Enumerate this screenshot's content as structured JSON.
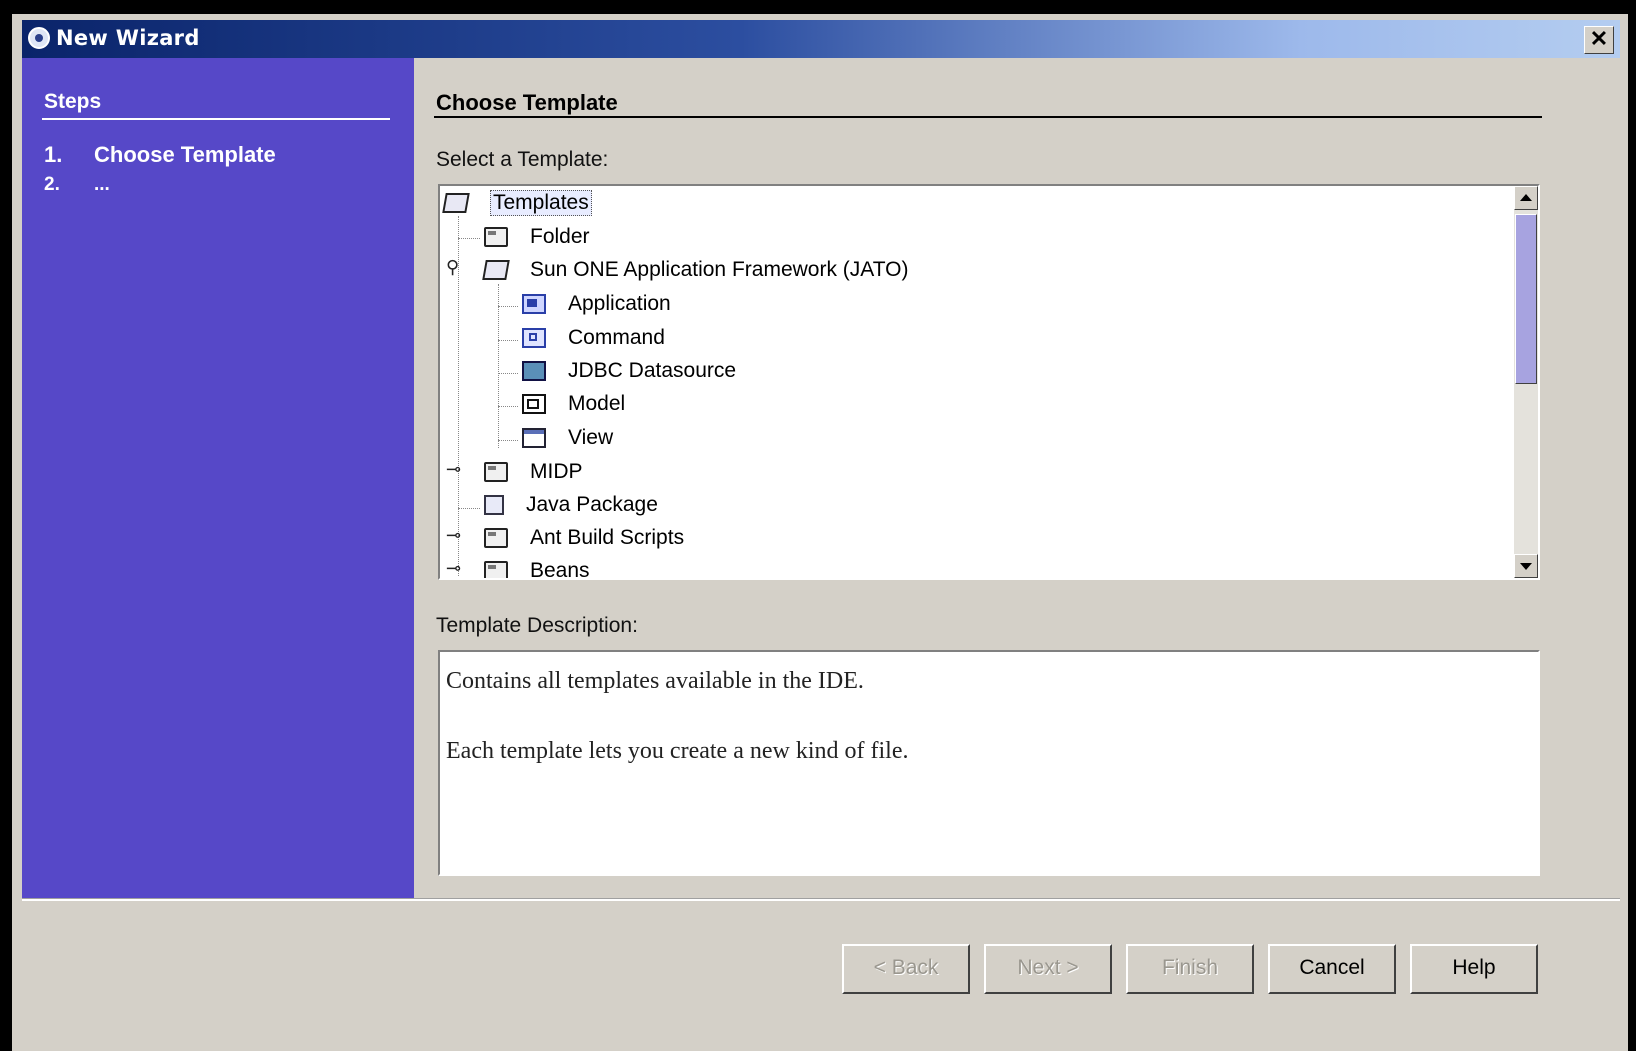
{
  "window": {
    "title": "New Wizard",
    "close_glyph": "✕"
  },
  "steps": {
    "title": "Steps",
    "items": [
      {
        "number": "1.",
        "label": "Choose Template"
      },
      {
        "number": "2.",
        "label": "..."
      }
    ]
  },
  "main": {
    "title": "Choose Template",
    "select_label": "Select a Template:",
    "tree": {
      "root": "Templates",
      "nodes": [
        {
          "label": "Folder",
          "icon": "folder-icon"
        },
        {
          "label": "Sun ONE Application Framework (JATO)",
          "icon": "open-folder-icon"
        },
        {
          "label": "Application",
          "icon": "application-icon"
        },
        {
          "label": "Command",
          "icon": "command-icon"
        },
        {
          "label": "JDBC Datasource",
          "icon": "jdbc-datasource-icon"
        },
        {
          "label": "Model",
          "icon": "model-icon"
        },
        {
          "label": "View",
          "icon": "view-icon"
        },
        {
          "label": "MIDP",
          "icon": "folder-icon"
        },
        {
          "label": "Java Package",
          "icon": "package-icon"
        },
        {
          "label": "Ant Build Scripts",
          "icon": "folder-icon"
        },
        {
          "label": "Beans",
          "icon": "folder-icon"
        }
      ]
    },
    "desc_label": "Template Description:",
    "description": {
      "line1": "Contains all templates available in the IDE.",
      "line2": "Each template lets you create a new kind of file."
    }
  },
  "buttons": {
    "back": "< Back",
    "next": "Next >",
    "finish": "Finish",
    "cancel": "Cancel",
    "help": "Help"
  },
  "colors": {
    "steps_panel": "#5648c8",
    "titlebar_start": "#0a246a",
    "titlebar_end": "#b4cdf0"
  }
}
